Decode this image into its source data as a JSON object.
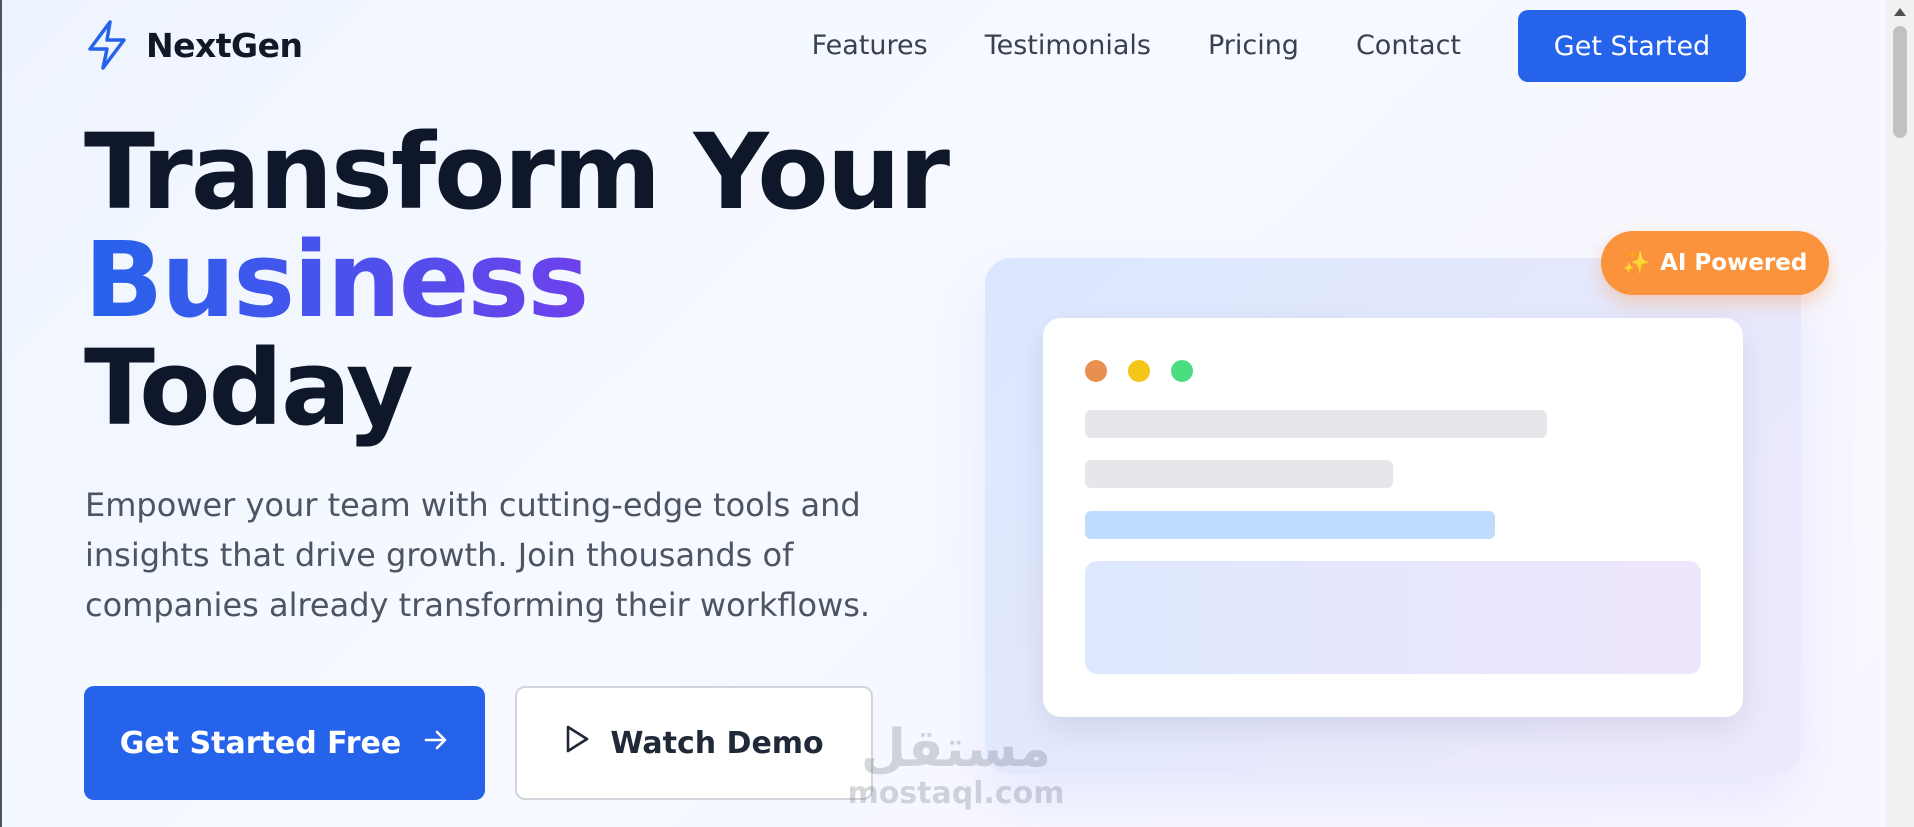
{
  "brand": {
    "name": "NextGen",
    "logo_icon": "lightning-bolt-icon",
    "accent": "#2563eb"
  },
  "nav": {
    "links": [
      "Features",
      "Testimonials",
      "Pricing",
      "Contact"
    ],
    "cta": "Get Started"
  },
  "hero": {
    "title_line1": "Transform Your",
    "title_line2": "Business",
    "title_line3": "Today",
    "subtitle": "Empower your team with cutting-edge tools and insights that drive growth. Join thousands of companies already transforming their workflows.",
    "primary_button": "Get Started Free",
    "primary_button_icon": "arrow-right-icon",
    "secondary_button": "Watch Demo",
    "secondary_button_icon": "play-icon"
  },
  "illustration": {
    "badge_icon": "sparkles-icon",
    "badge_label": "AI Powered",
    "badge_color": "#fb923c",
    "window_dot_colors": [
      "#e8904f",
      "#f5c518",
      "#4ade80"
    ]
  },
  "watermark": {
    "arabic": "مستقل",
    "latin": "mostaql.com"
  }
}
